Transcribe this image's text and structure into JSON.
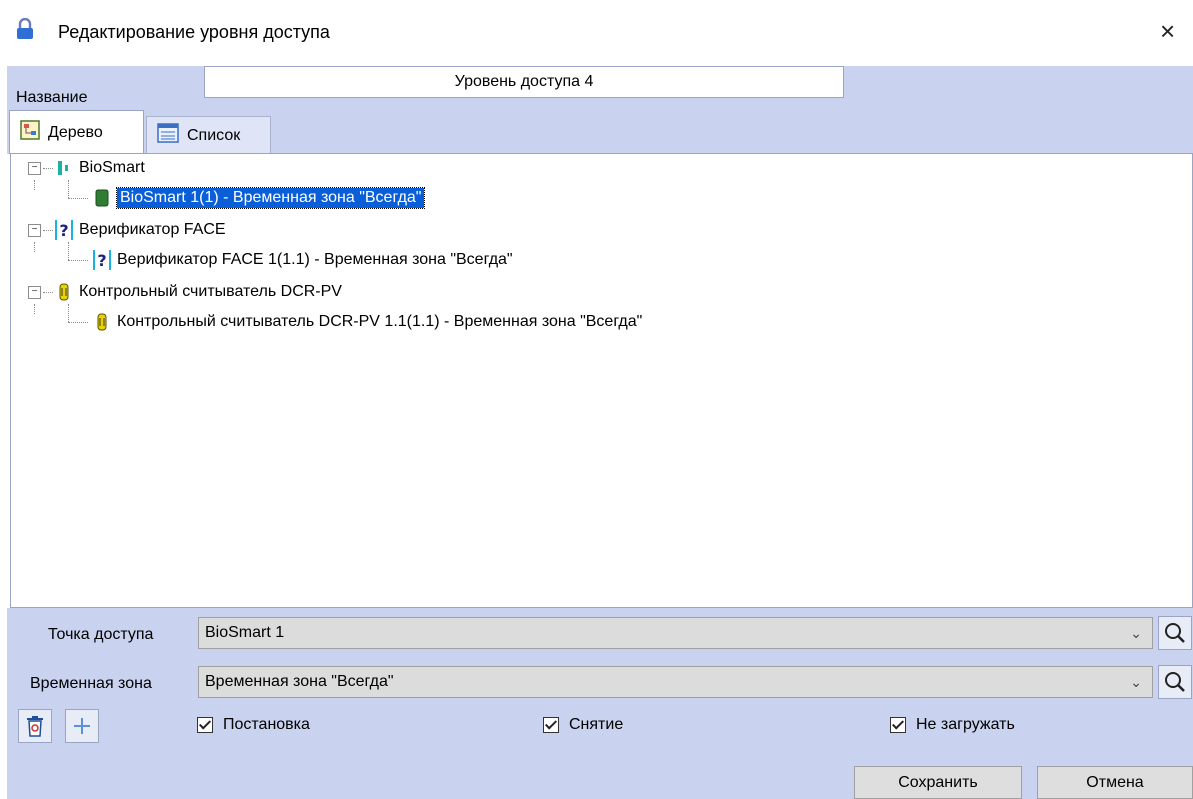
{
  "window": {
    "title": "Редактирование уровня доступа",
    "close_glyph": "×"
  },
  "name": {
    "label": "Название",
    "value": "Уровень доступа 4"
  },
  "tabs": [
    {
      "label": "Дерево",
      "active": true,
      "icon": "tree-view-icon"
    },
    {
      "label": "Список",
      "active": false,
      "icon": "list-view-icon"
    }
  ],
  "tree": {
    "groups": [
      {
        "label": "BioSmart",
        "icon": "biosmart-icon",
        "child": {
          "label": "BioSmart 1(1) - Временная зона \"Всегда\"",
          "icon": "biosmart-device-icon",
          "selected": true
        }
      },
      {
        "label": "Верификатор FACE",
        "icon": "question-icon",
        "child": {
          "label": "Верификатор FACE 1(1.1) - Временная зона \"Всегда\"",
          "icon": "question-icon",
          "selected": false
        }
      },
      {
        "label": "Контрольный считыватель DCR-PV",
        "icon": "reader-icon",
        "child": {
          "label": "Контрольный считыватель DCR-PV 1.1(1.1) - Временная зона \"Всегда\"",
          "icon": "reader-icon",
          "selected": false
        }
      }
    ]
  },
  "form": {
    "access_point": {
      "label": "Точка доступа",
      "value": "BioSmart 1"
    },
    "time_zone": {
      "label": "Временная зона",
      "value": "Временная зона \"Всегда\""
    },
    "checkboxes": [
      {
        "label": "Постановка",
        "checked": true
      },
      {
        "label": "Снятие",
        "checked": true
      },
      {
        "label": "Не загружать",
        "checked": true
      }
    ]
  },
  "buttons": {
    "save": "Сохранить",
    "cancel": "Отмена"
  },
  "colors": {
    "panel": "#c9d3f0",
    "selection": "#0a5fd8"
  }
}
